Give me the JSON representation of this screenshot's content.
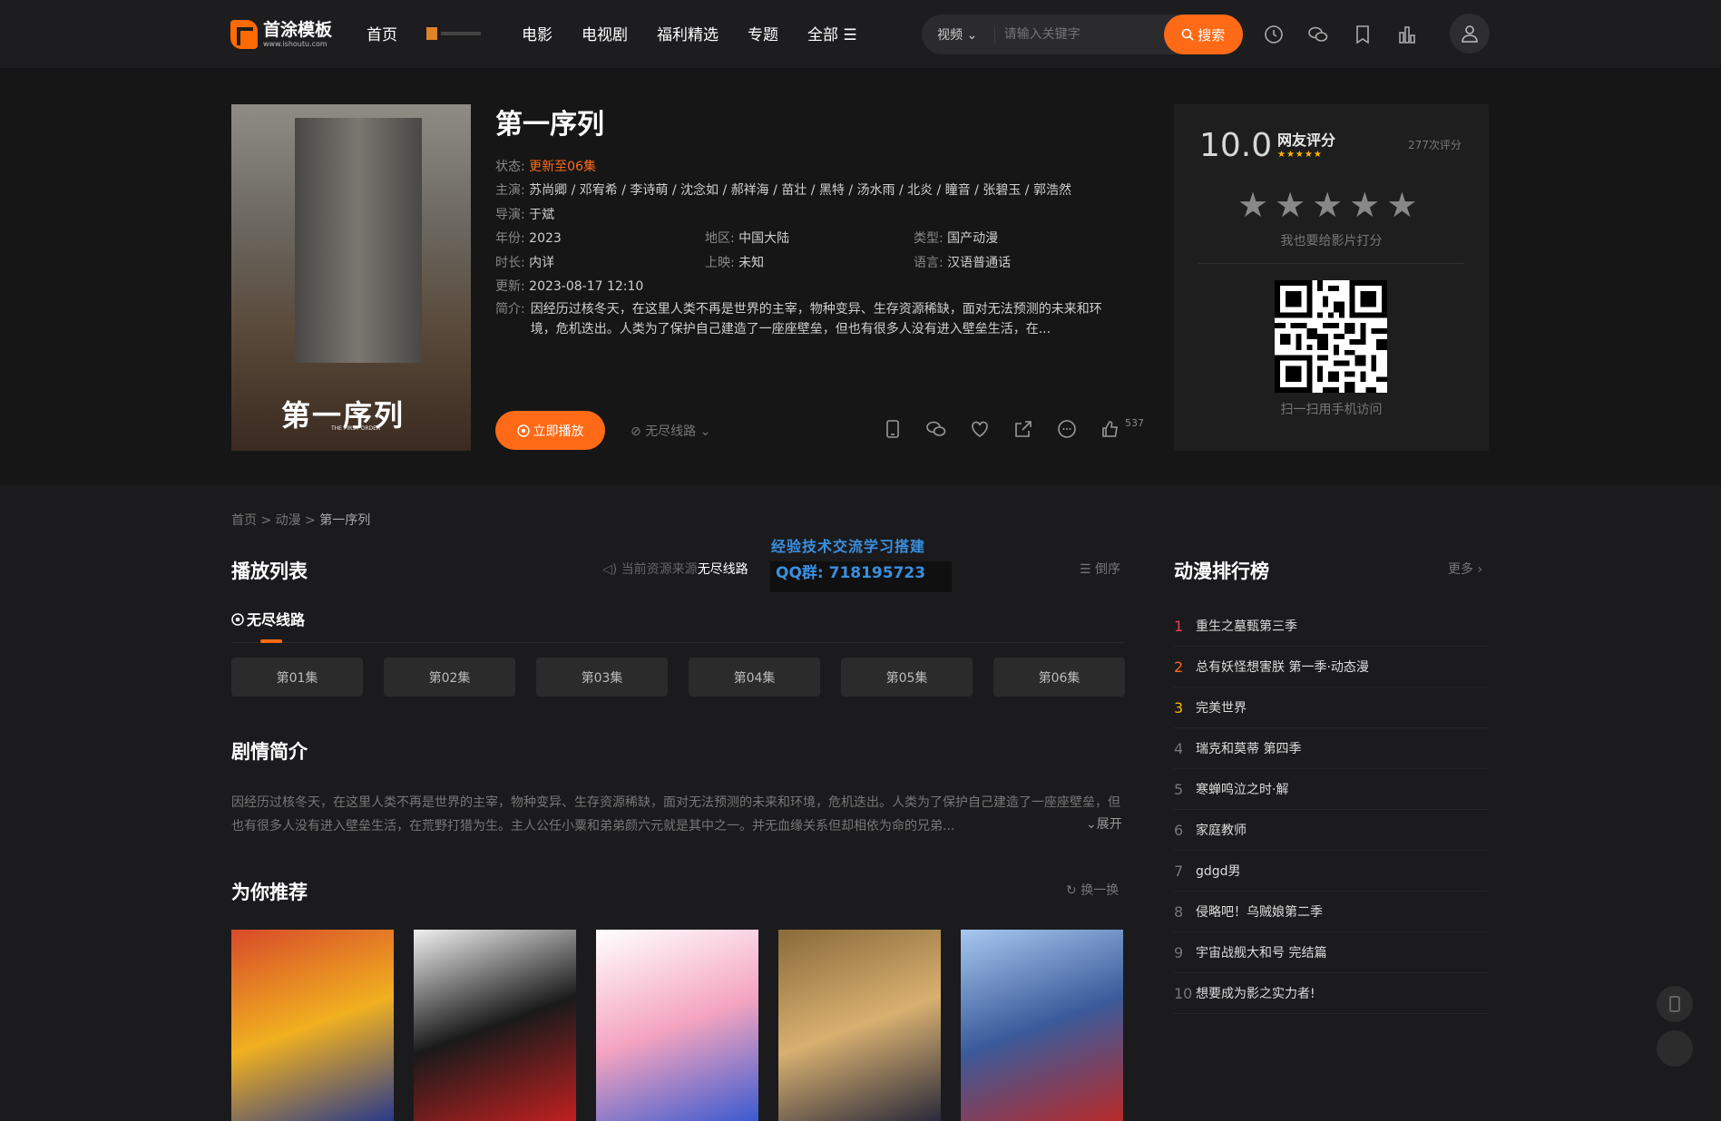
{
  "header": {
    "logo_text": "首涂模板",
    "logo_sub": "www.ishoutu.com",
    "nav": [
      "首页",
      "电影",
      "电视剧",
      "福利精选",
      "专题",
      "全部 ☰"
    ],
    "search": {
      "type_label": "视频",
      "placeholder": "请输入关键字",
      "button_label": "搜索"
    }
  },
  "detail": {
    "title": "第一序列",
    "poster_title": "第一序列",
    "poster_sub": "THE FIRST ORDER",
    "status_label": "状态:",
    "status_value": "更新至06集",
    "cast_label": "主演:",
    "cast_value": "苏尚卿 / 邓宥希 / 李诗萌 / 沈念如 / 郝祥海 / 苗壮 / 黑特 / 汤水雨 / 北炎 / 瞳音 / 张碧玉 / 郭浩然",
    "director_label": "导演:",
    "director_value": "于斌",
    "year_label": "年份:",
    "year_value": "2023",
    "region_label": "地区:",
    "region_value": "中国大陆",
    "type_label": "类型:",
    "type_value": "国产动漫",
    "duration_label": "时长:",
    "duration_value": "内详",
    "release_label": "上映:",
    "release_value": "未知",
    "lang_label": "语言:",
    "lang_value": "汉语普通话",
    "update_label": "更新:",
    "update_value": "2023-08-17 12:10",
    "synopsis_label": "简介:",
    "synopsis_value": "因经历过核冬天，在这里人类不再是世界的主宰，物种变异、生存资源稀缺，面对无法预测的未来和环境，危机迭出。人类为了保护自己建造了一座座壁垒，但也有很多人没有进入壁垒生活，在...",
    "play_label": "立即播放",
    "line_label": "无尽线路",
    "like_count": "537"
  },
  "rating": {
    "score": "10.0",
    "label": "网友评分",
    "mini_stars": "★★★★★",
    "count": "277次评分",
    "big_stars": [
      "★",
      "★",
      "★",
      "★",
      "★"
    ],
    "rate_prompt": "我也要给影片打分",
    "qr_caption": "扫一扫用手机访问"
  },
  "breadcrumb": {
    "items": [
      "首页",
      "动漫",
      "第一序列"
    ]
  },
  "playlist": {
    "title": "播放列表",
    "source_prefix": "当前资源来源",
    "source_name": "无尽线路",
    "sort_label": "倒序",
    "tab": "无尽线路",
    "episodes": [
      "第01集",
      "第02集",
      "第03集",
      "第04集",
      "第05集",
      "第06集"
    ]
  },
  "watermark": {
    "line1": "经验技术交流学习搭建",
    "line2": "QQ群: 718195723"
  },
  "plot": {
    "title": "剧情简介",
    "text": "因经历过核冬天，在这里人类不再是世界的主宰，物种变异、生存资源稀缺，面对无法预测的未来和环境，危机迭出。人类为了保护自己建造了一座座壁垒，但也有很多人没有进入壁垒生活，在荒野打猎为生。主人公任小粟和弟弟颜六元就是其中之一。并无血缘关系但却相依为命的兄弟...",
    "expand_label": "展开"
  },
  "recommend": {
    "title": "为你推荐",
    "refresh_label": "换一换",
    "items": [
      {
        "colors": [
          "#d84a2a",
          "#f0b020",
          "#2a3a8a"
        ]
      },
      {
        "colors": [
          "#f0f0f0",
          "#1a1a1a",
          "#c02020"
        ]
      },
      {
        "colors": [
          "#ffffff",
          "#f4a4c0",
          "#3a5ad0"
        ]
      },
      {
        "colors": [
          "#8a6a3a",
          "#d8b070",
          "#2a2a3a"
        ]
      },
      {
        "colors": [
          "#a8c8f0",
          "#3a5a9a",
          "#b82a2a"
        ]
      }
    ]
  },
  "ranking": {
    "title": "动漫排行榜",
    "more_label": "更多",
    "items": [
      {
        "num": "1",
        "name": "重生之墓甄第三季"
      },
      {
        "num": "2",
        "name": "总有妖怪想害朕 第一季·动态漫"
      },
      {
        "num": "3",
        "name": "完美世界"
      },
      {
        "num": "4",
        "name": "瑞克和莫蒂 第四季"
      },
      {
        "num": "5",
        "name": "寒蝉鸣泣之时·解"
      },
      {
        "num": "6",
        "name": "家庭教师"
      },
      {
        "num": "7",
        "name": "gdgd男"
      },
      {
        "num": "8",
        "name": "侵略吧！乌贼娘第二季"
      },
      {
        "num": "9",
        "name": "宇宙战舰大和号 完结篇"
      },
      {
        "num": "10",
        "name": "想要成为影之实力者!"
      }
    ]
  },
  "colors": {
    "accent": "#ff6a17",
    "bg": "#1b1b1d"
  }
}
